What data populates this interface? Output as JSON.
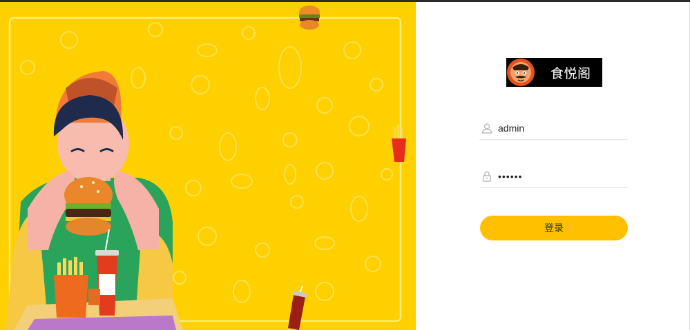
{
  "brand": {
    "name": "食悦阁",
    "logo_icon": "chef-mascot-icon"
  },
  "form": {
    "username": {
      "value": "admin",
      "icon": "user-icon"
    },
    "password": {
      "value": "••••••",
      "icon": "lock-icon"
    },
    "submit_label": "登录"
  },
  "colors": {
    "illustration_bg": "#ffd000",
    "button": "#ffc000",
    "panel_bg": "#ffffff"
  }
}
